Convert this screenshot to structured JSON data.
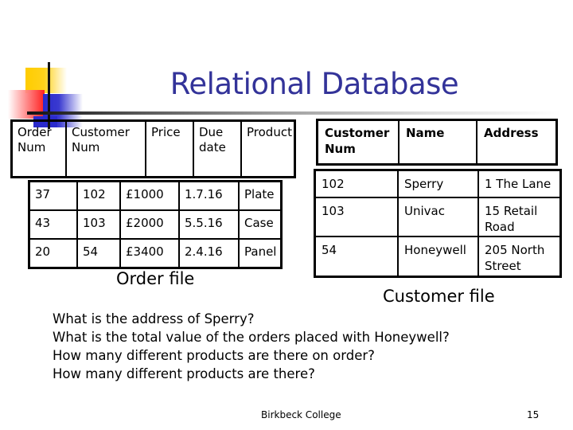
{
  "slide": {
    "title": "Relational Database",
    "title_color": "#333399",
    "footer": "Birkbeck College",
    "page_number": "15"
  },
  "order_file": {
    "caption": "Order file",
    "headers": [
      {
        "line1": "Order",
        "line2": "Num"
      },
      {
        "line1": "Customer",
        "line2": "Num"
      },
      {
        "line1": "Price",
        "line2": ""
      },
      {
        "line1": "Due",
        "line2": "date"
      },
      {
        "line1": "Product",
        "line2": ""
      }
    ],
    "rows": [
      [
        "37",
        "102",
        "£1000",
        "1.7.16",
        "Plate"
      ],
      [
        "43",
        "103",
        "£2000",
        "5.5.16",
        "Case"
      ],
      [
        "20",
        "54",
        "£3400",
        "2.4.16",
        "Panel"
      ]
    ]
  },
  "customer_file": {
    "caption": "Customer file",
    "headers": [
      {
        "line1": "Customer",
        "line2": "Num"
      },
      {
        "line1": "Name",
        "line2": ""
      },
      {
        "line1": "Address",
        "line2": ""
      }
    ],
    "rows": [
      {
        "num": "102",
        "name": "Sperry",
        "addr1": "1 The Lane",
        "addr2": ""
      },
      {
        "num": "103",
        "name": "Univac",
        "addr1": "15 Retail",
        "addr2": "Road"
      },
      {
        "num": "54",
        "name": "Honeywell",
        "addr1": "205 North",
        "addr2": "Street"
      }
    ]
  },
  "questions": [
    "What is the address of Sperry?",
    "What is the total value of the orders placed with Honeywell?",
    "How many different products are there on order?",
    "How many different products are there?"
  ]
}
